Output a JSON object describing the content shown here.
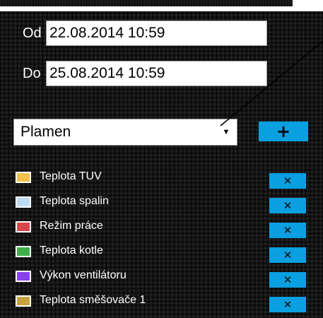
{
  "date_range": {
    "from_label": "Od",
    "from_value": "22.08.2014 10:59",
    "to_label": "Do",
    "to_value": "25.08.2014 10:59"
  },
  "series_select": {
    "selected": "Plamen",
    "add_label": "+"
  },
  "series": [
    {
      "label": "Teplota TUV",
      "color": "#f2c24c",
      "remove_label": "✕"
    },
    {
      "label": "Teplota spalin",
      "color": "#bcdcf5",
      "remove_label": "✕"
    },
    {
      "label": "Režim práce",
      "color": "#d9464a",
      "remove_label": "✕"
    },
    {
      "label": "Teplota kotle",
      "color": "#3fae49",
      "remove_label": "✕"
    },
    {
      "label": "Výkon ventilátoru",
      "color": "#8a3ff0",
      "remove_label": "✕"
    },
    {
      "label": "Teplota směšovače 1",
      "color": "#c8a23e",
      "remove_label": "✕"
    }
  ],
  "colors": {
    "accent": "#0a9fe0"
  }
}
